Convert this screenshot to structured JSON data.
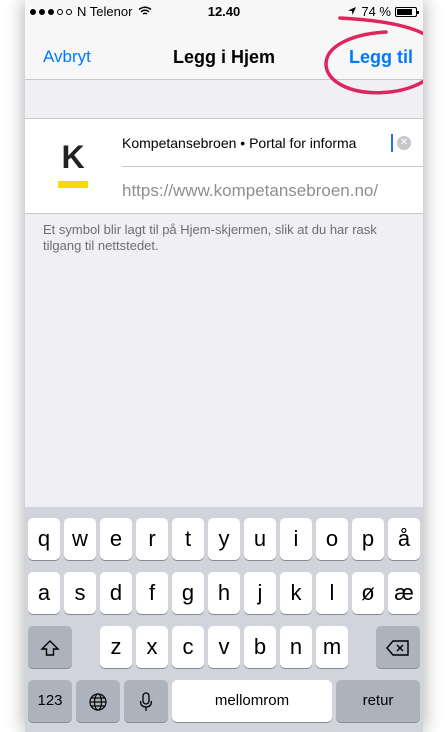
{
  "status_bar": {
    "carrier": "N Telenor",
    "time": "12.40",
    "battery_text": "74 %",
    "battery_level": 0.74
  },
  "nav": {
    "cancel_label": "Avbryt",
    "title": "Legg i Hjem",
    "add_label": "Legg til"
  },
  "annotation": {
    "color": "#e0245e"
  },
  "site": {
    "icon_letter": "K",
    "icon_bar_color": "#f5d90a",
    "title_value": "Kompetansebroen • Portal for informa",
    "url": "https://www.kompetansebroen.no/"
  },
  "info_text": "Et symbol blir lagt til på Hjem-skjermen, slik at du har rask tilgang til nettstedet.",
  "keyboard": {
    "row1": [
      "q",
      "w",
      "e",
      "r",
      "t",
      "y",
      "u",
      "i",
      "o",
      "p",
      "å"
    ],
    "row2": [
      "a",
      "s",
      "d",
      "f",
      "g",
      "h",
      "j",
      "k",
      "l",
      "ø",
      "æ"
    ],
    "row3": [
      "z",
      "x",
      "c",
      "v",
      "b",
      "n",
      "m"
    ],
    "numbers_label": "123",
    "space_label": "mellomrom",
    "return_label": "retur"
  },
  "colors": {
    "accent": "#007aff",
    "keyboard_bg": "#d1d5db"
  }
}
